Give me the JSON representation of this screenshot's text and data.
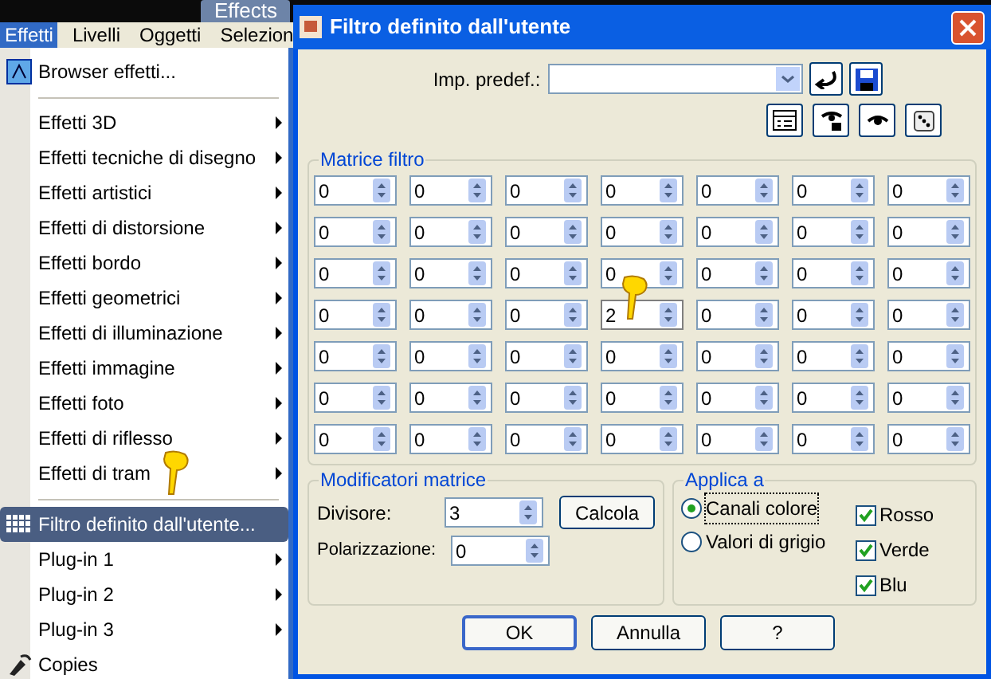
{
  "app_tab": {
    "label": "Effects"
  },
  "menu_bar": [
    {
      "label": "Effetti",
      "selected": true
    },
    {
      "label": "Livelli",
      "selected": false
    },
    {
      "label": "Oggetti",
      "selected": false
    },
    {
      "label": "Selezion",
      "selected": false
    }
  ],
  "menu_items": [
    {
      "kind": "icon",
      "label": "Browser effetti...",
      "submenu": false,
      "selected": false
    },
    {
      "kind": "separator"
    },
    {
      "kind": "item",
      "label": "Effetti 3D",
      "submenu": true,
      "selected": false
    },
    {
      "kind": "item",
      "label": "Effetti tecniche di disegno",
      "submenu": true,
      "selected": false
    },
    {
      "kind": "item",
      "label": "Effetti artistici",
      "submenu": true,
      "selected": false
    },
    {
      "kind": "item",
      "label": "Effetti di distorsione",
      "submenu": true,
      "selected": false
    },
    {
      "kind": "item",
      "label": "Effetti bordo",
      "submenu": true,
      "selected": false
    },
    {
      "kind": "item",
      "label": "Effetti geometrici",
      "submenu": true,
      "selected": false
    },
    {
      "kind": "item",
      "label": "Effetti di illuminazione",
      "submenu": true,
      "selected": false
    },
    {
      "kind": "item",
      "label": "Effetti immagine",
      "submenu": true,
      "selected": false
    },
    {
      "kind": "item",
      "label": "Effetti foto",
      "submenu": true,
      "selected": false
    },
    {
      "kind": "item",
      "label": "Effetti di riflesso",
      "submenu": true,
      "selected": false
    },
    {
      "kind": "item",
      "label": "Effetti di tram",
      "submenu": true,
      "selected": false
    },
    {
      "kind": "separator"
    },
    {
      "kind": "grid",
      "label": "Filtro definito dall'utente...",
      "submenu": false,
      "selected": true
    },
    {
      "kind": "item",
      "label": "Plug-in 1",
      "submenu": true,
      "selected": false
    },
    {
      "kind": "item",
      "label": "Plug-in 2",
      "submenu": true,
      "selected": false
    },
    {
      "kind": "item",
      "label": "Plug-in 3",
      "submenu": true,
      "selected": false
    },
    {
      "kind": "copies",
      "label": "Copies",
      "submenu": false,
      "selected": false
    }
  ],
  "dialog": {
    "title": "Filtro definito dall'utente",
    "preset_label": "Imp. predef.:",
    "matrix": {
      "title": "Matrice filtro",
      "rows": [
        [
          "0",
          "0",
          "0",
          "0",
          "0",
          "0",
          "0"
        ],
        [
          "0",
          "0",
          "0",
          "0",
          "0",
          "0",
          "0"
        ],
        [
          "0",
          "0",
          "0",
          "0",
          "0",
          "0",
          "0"
        ],
        [
          "0",
          "0",
          "0",
          "2",
          "0",
          "0",
          "0"
        ],
        [
          "0",
          "0",
          "0",
          "0",
          "0",
          "0",
          "0"
        ],
        [
          "0",
          "0",
          "0",
          "0",
          "0",
          "0",
          "0"
        ],
        [
          "0",
          "0",
          "0",
          "0",
          "0",
          "0",
          "0"
        ]
      ]
    },
    "modifiers": {
      "title": "Modificatori matrice",
      "divisor_label": "Divisore:",
      "divisor": "3",
      "bias_label": "Polarizzazione:",
      "bias": "0",
      "compute_button": "Calcola"
    },
    "apply_to": {
      "title": "Applica a",
      "radios": [
        {
          "label": "Canali colore",
          "selected": true
        },
        {
          "label": "Valori di grigio",
          "selected": false
        }
      ],
      "checkboxes": [
        {
          "label": "Rosso",
          "checked": true
        },
        {
          "label": "Verde",
          "checked": true
        },
        {
          "label": "Blu",
          "checked": true
        }
      ]
    },
    "buttons": [
      {
        "label": "OK",
        "default": true
      },
      {
        "label": "Annulla",
        "default": false
      },
      {
        "label": "?",
        "default": false
      }
    ]
  }
}
